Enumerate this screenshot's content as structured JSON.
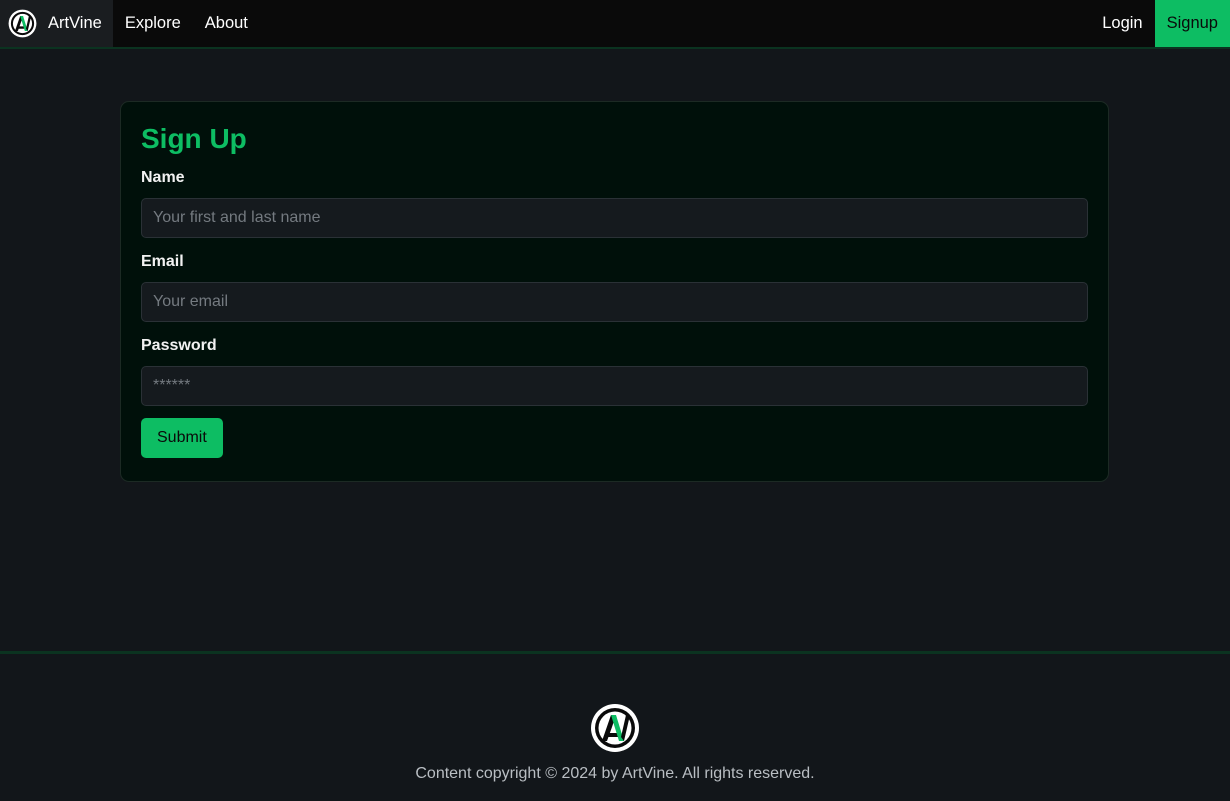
{
  "nav": {
    "brand": "ArtVine",
    "links": [
      "Explore",
      "About"
    ],
    "login_label": "Login",
    "signup_label": "Signup"
  },
  "form": {
    "title": "Sign Up",
    "name_label": "Name",
    "name_placeholder": "Your first and last name",
    "email_label": "Email",
    "email_placeholder": "Your email",
    "password_label": "Password",
    "password_placeholder": "******",
    "submit_label": "Submit"
  },
  "footer": {
    "copyright": "Content copyright © 2024 by ArtVine. All rights reserved."
  },
  "colors": {
    "accent": "#0dbd63",
    "background": "#12161a",
    "card": "#00100a"
  },
  "icons": {
    "brand_logo": "artvine-logo-icon"
  }
}
